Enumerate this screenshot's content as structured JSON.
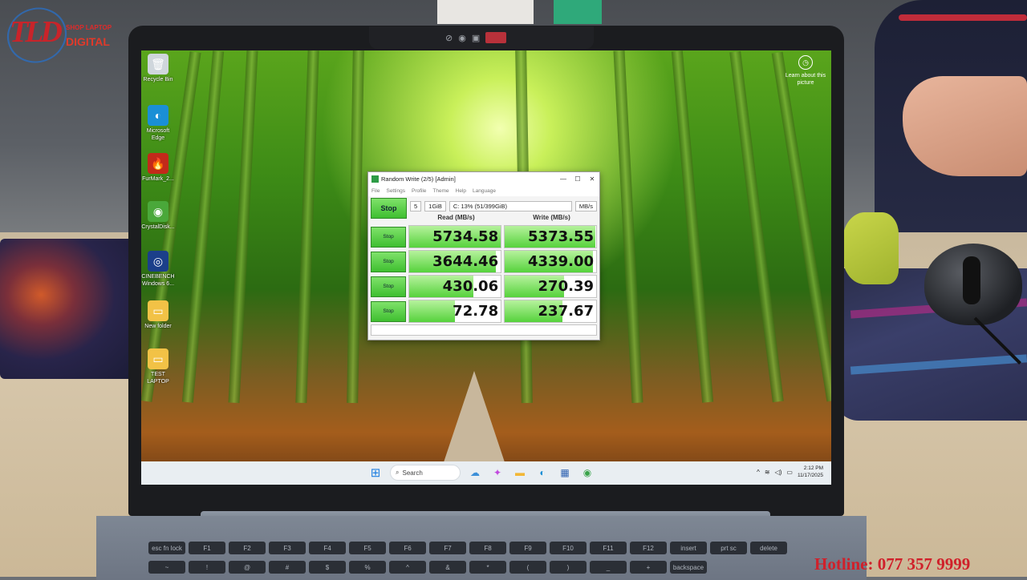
{
  "overlay": {
    "logo_text": "TLD",
    "logo_tagline": "SHOP LAPTOP",
    "logo_sub": "DIGITAL",
    "hotline": "Hotline: 077 357 9999"
  },
  "desktop": {
    "icons": [
      {
        "label": "Recycle Bin",
        "icon": "recycle-bin-icon",
        "glyph": "🗑",
        "color": "#cfd6dc"
      },
      {
        "label": "Microsoft Edge",
        "icon": "edge-icon",
        "glyph": "◐",
        "color": "#1a8fd6"
      },
      {
        "label": "FurMark_2...",
        "icon": "furmark-icon",
        "glyph": "🔥",
        "color": "#c22a1a"
      },
      {
        "label": "CrystalDisk...",
        "icon": "crystaldisk-icon",
        "glyph": "◉",
        "color": "#4aa83a"
      },
      {
        "label": "CINEBENCH Windows 6...",
        "icon": "cinebench-icon",
        "glyph": "◎",
        "color": "#1b3f8a"
      },
      {
        "label": "New folder",
        "icon": "folder-icon",
        "glyph": "▭",
        "color": "#f2c246"
      },
      {
        "label": "TEST LAPTOP",
        "icon": "folder-icon",
        "glyph": "▭",
        "color": "#f2c246"
      }
    ],
    "learn_about": "Learn about this picture"
  },
  "window": {
    "title": "Random Write (2/5) [Admin]",
    "menu": [
      "File",
      "Settings",
      "Profile",
      "Theme",
      "Help",
      "Language"
    ],
    "controls": {
      "minimize": "—",
      "maximize": "☐",
      "close": "✕"
    },
    "toolbar": {
      "main_button": "Stop",
      "count": "5",
      "size": "1GiB",
      "drive": "C: 13% (51/399GiB)",
      "unit": "MB/s"
    },
    "headers": {
      "read": "Read (MB/s)",
      "write": "Write (MB/s)"
    },
    "rows": [
      {
        "button": "Stop",
        "read": "5734.58",
        "write": "5373.55"
      },
      {
        "button": "Stop",
        "read": "3644.46",
        "write": "4339.00"
      },
      {
        "button": "Stop",
        "read": "430.06",
        "write": "270.39"
      },
      {
        "button": "Stop",
        "read": "72.78",
        "write": "237.67"
      }
    ]
  },
  "taskbar": {
    "search_placeholder": "Search",
    "apps": [
      {
        "icon": "widgets-icon",
        "glyph": "☁",
        "color": "#3b8fd8"
      },
      {
        "icon": "copilot-icon",
        "glyph": "✦",
        "color": "#c24adf"
      },
      {
        "icon": "file-explorer-icon",
        "glyph": "▬",
        "color": "#f2b736"
      },
      {
        "icon": "edge-icon",
        "glyph": "◐",
        "color": "#1a8fd6"
      },
      {
        "icon": "store-icon",
        "glyph": "▦",
        "color": "#2a5fb0"
      },
      {
        "icon": "crystaldisk-icon",
        "glyph": "◉",
        "color": "#3aa34a"
      }
    ],
    "tray": {
      "chevron": "^",
      "wifi": "≋",
      "volume": "◁)",
      "battery": "▭"
    },
    "time": "2:12 PM",
    "date": "11/17/2025"
  },
  "keyboard": {
    "keys": [
      "esc fn lock",
      "F1",
      "F2",
      "F3",
      "F4",
      "F5",
      "F6",
      "F7",
      "F8",
      "F9",
      "F10",
      "F11",
      "F12",
      "insert",
      "prt sc",
      "delete",
      "~",
      "!",
      "@",
      "#",
      "$",
      "%",
      "^",
      "&",
      "*",
      "(",
      ")",
      "_",
      "+",
      "backspace"
    ]
  }
}
